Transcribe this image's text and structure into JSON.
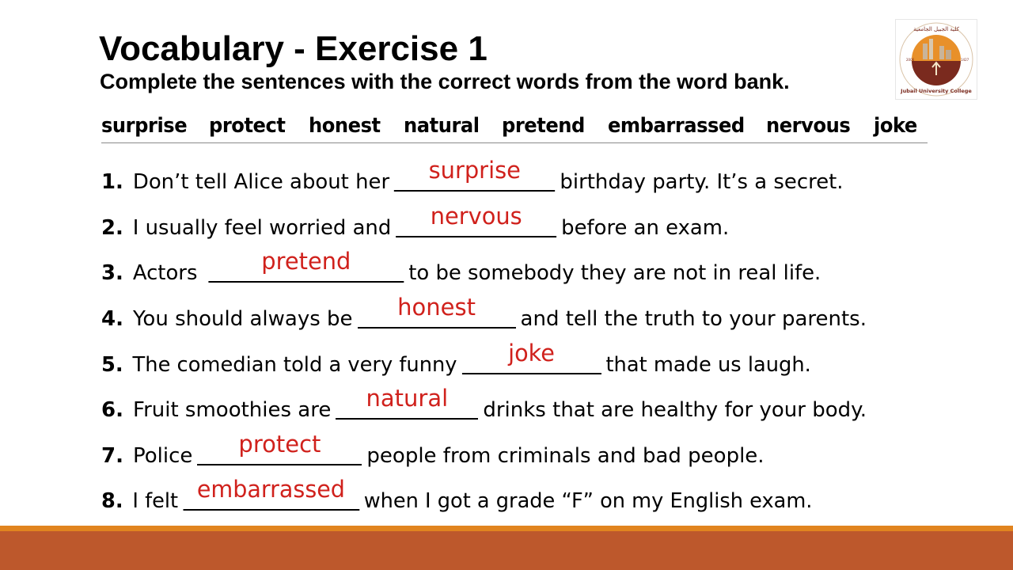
{
  "header": {
    "title": "Vocabulary - Exercise 1",
    "instructions": "Complete the sentences with the correct words from the word bank."
  },
  "logo": {
    "arabic_text": "كلية الجبيل الجامعية",
    "english_text": "Jubail University College",
    "year_left": "2006",
    "year_right": "1427",
    "colors": {
      "ring": "#ffffff",
      "inner": "#e8902a",
      "base": "#7a2a1e",
      "text": "#7a2a1e"
    }
  },
  "word_bank": [
    "surprise",
    "protect",
    "honest",
    "natural",
    "pretend",
    "embarrassed",
    "nervous",
    "joke"
  ],
  "items": [
    {
      "number": "1.",
      "before": "Don’t tell Alice about her",
      "answer": "surprise",
      "after": "birthday party. It’s a secret."
    },
    {
      "number": "2.",
      "before": "I usually feel worried and",
      "answer": "nervous",
      "after": "before an exam."
    },
    {
      "number": "3.",
      "before": "Actors",
      "answer": "pretend",
      "after": "to be somebody they are not in real life."
    },
    {
      "number": "4.",
      "before": "You should always be",
      "answer": "honest",
      "after": "and tell the truth to your parents."
    },
    {
      "number": "5.",
      "before": "The comedian told a very funny",
      "answer": "joke",
      "after": "that made us laugh."
    },
    {
      "number": "6.",
      "before": "Fruit smoothies are",
      "answer": "natural",
      "after": "drinks that are healthy for your body."
    },
    {
      "number": "7.",
      "before": "Police",
      "answer": "protect",
      "after": "people from criminals and bad people."
    },
    {
      "number": "8.",
      "before": "I felt",
      "answer": "embarrassed",
      "after": "when I got a grade “F” on my English exam."
    }
  ],
  "colors": {
    "answer": "#d0211c",
    "footer_accent": "#e1841f",
    "footer_main": "#bd582c"
  }
}
